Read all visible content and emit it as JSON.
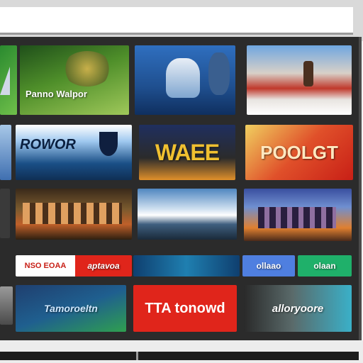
{
  "tiles": {
    "row1": [
      {
        "label": "",
        "color": "#2a8a2f"
      },
      {
        "label": "Panno Walpor",
        "color": "#4f8f2a"
      },
      {
        "label": "",
        "color": "#1f5f9f"
      },
      {
        "label": "",
        "color": "#c9c3bd"
      }
    ],
    "row2": [
      {
        "label": "",
        "color": "#5f86c8"
      },
      {
        "label": "ROWOR",
        "color": "#1a4f86"
      },
      {
        "label": "WAEE",
        "color": "#2b2b2b"
      },
      {
        "label": "POOLGT",
        "color": "#c81f16"
      }
    ],
    "row3": [
      {
        "label": "",
        "color": "#5a4a2e"
      },
      {
        "label": "",
        "color": "#7a5a2e"
      },
      {
        "label": "",
        "color": "#4f86c0"
      },
      {
        "label": "",
        "color": "#3a4f9f"
      }
    ],
    "row4": [
      {
        "label": "",
        "color": "#ffffff"
      },
      {
        "label": "NSO EOAA",
        "color": "#ffffff"
      },
      {
        "label": "aptavoa",
        "color": "#e0251b"
      },
      {
        "label": "",
        "color": "#1f7fb0"
      },
      {
        "label": "ollaao",
        "color": "#4f7fe0"
      },
      {
        "label": "olaan",
        "color": "#1fb06a"
      }
    ],
    "row5": [
      {
        "label": "",
        "color": "#7a7a7a"
      },
      {
        "label": "Tamoroeltn",
        "color": "#1f3f6f"
      },
      {
        "label": "TTA tonowd",
        "color": "#e0251b"
      },
      {
        "label": "alloryoore",
        "color": "#3ab0c8"
      }
    ]
  }
}
